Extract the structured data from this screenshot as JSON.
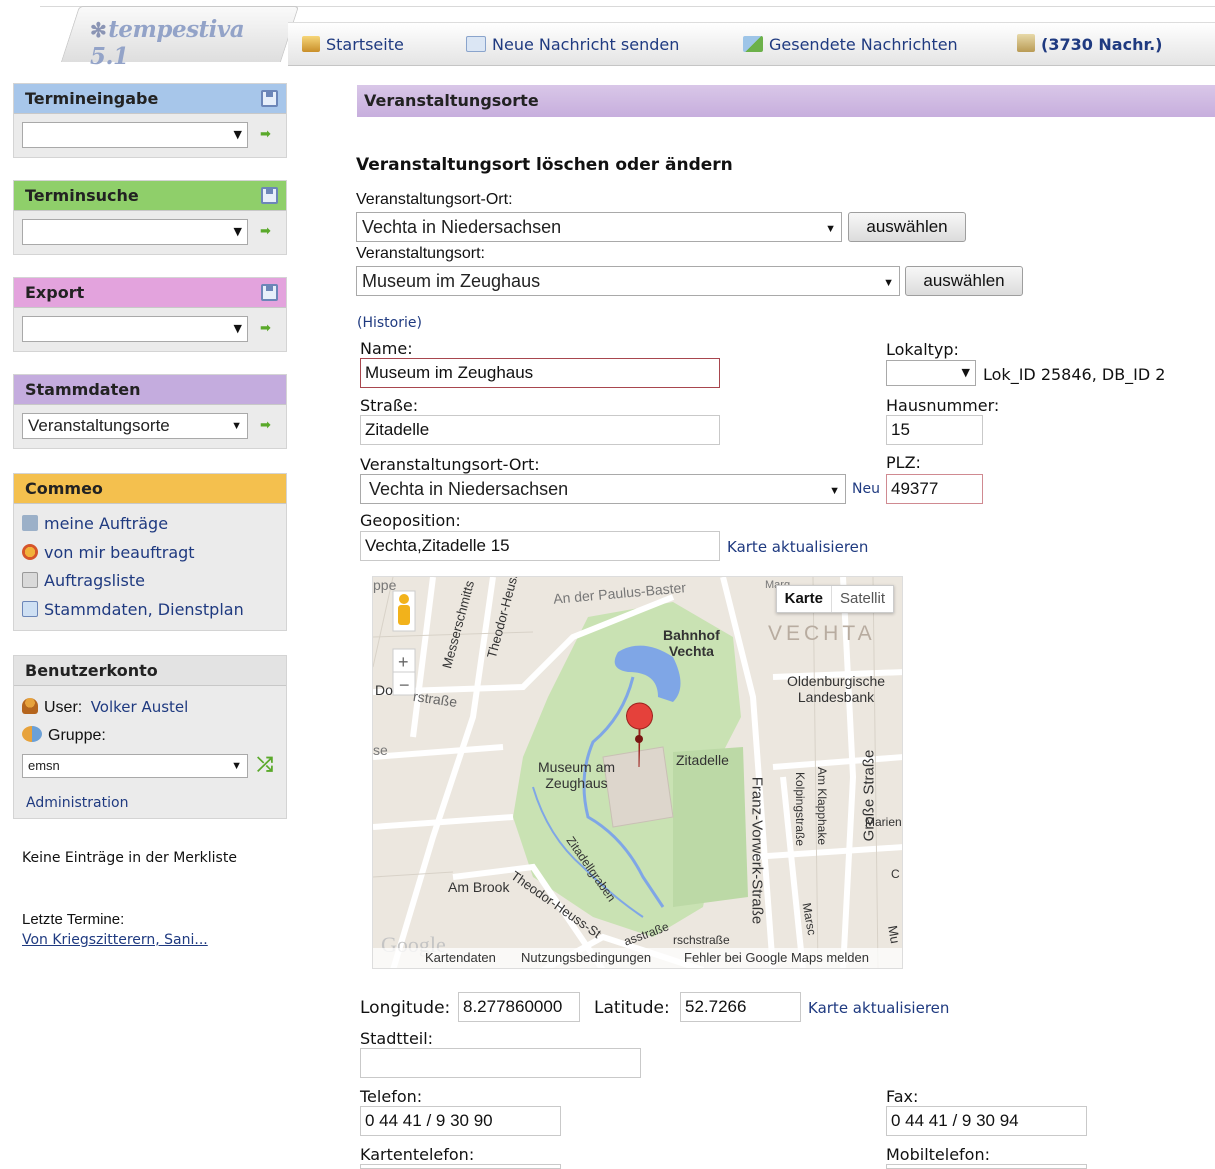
{
  "app": {
    "logo": "tempestiva 5.1"
  },
  "nav": {
    "home": "Startseite",
    "new_message": "Neue Nachricht senden",
    "sent_messages": "Gesendete Nachrichten",
    "messages_count": "(3730 Nachr.)"
  },
  "sidebar": {
    "termineingabe": {
      "title": "Termineingabe",
      "value": ""
    },
    "terminsuche": {
      "title": "Terminsuche",
      "value": ""
    },
    "export": {
      "title": "Export",
      "value": ""
    },
    "stammdaten": {
      "title": "Stammdaten",
      "value": "Veranstaltungsorte"
    },
    "commeo": {
      "title": "Commeo",
      "items": [
        "meine Aufträge",
        "von mir beauftragt",
        "Auftragsliste",
        "Stammdaten, Dienstplan"
      ]
    },
    "account": {
      "title": "Benutzerkonto",
      "user_label": "User:",
      "user_name": "Volker Austel",
      "group_label": "Gruppe:",
      "group_value": "emsn",
      "admin_link": "Administration"
    },
    "merkliste": "Keine Einträge in der Merkliste",
    "last_label": "Letzte Termine:",
    "last_link": "Von Kriegszitterern, Sani..."
  },
  "main": {
    "header": "Veranstaltungsorte",
    "section_title": "Veranstaltungsort löschen oder ändern",
    "place_city_label": "Veranstaltungsort-Ort:",
    "place_city_value": "Vechta in Niedersachsen",
    "select_button": "auswählen",
    "place_label": "Veranstaltungsort:",
    "place_value": "Museum im Zeughaus",
    "history_link": "(Historie)",
    "name_label": "Name:",
    "name_value": "Museum im Zeughaus",
    "lokaltyp_label": "Lokaltyp:",
    "lokaltyp_value": "",
    "lok_info": "Lok_ID 25846, DB_ID 2",
    "street_label": "Straße:",
    "street_value": "Zitadelle",
    "housenr_label": "Hausnummer:",
    "housenr_value": "15",
    "city_label": "Veranstaltungsort-Ort:",
    "city_value": "Vechta in Niedersachsen",
    "new_link": "Neu",
    "plz_label": "PLZ:",
    "plz_value": "49377",
    "geo_label": "Geoposition:",
    "geo_value": "Vechta,Zitadelle 15",
    "update_map": "Karte aktualisieren",
    "longitude_label": "Longitude:",
    "longitude_value": "8.277860000",
    "latitude_label": "Latitude:",
    "latitude_value": "52.7266",
    "district_label": "Stadtteil:",
    "district_value": "",
    "phone_label": "Telefon:",
    "phone_value": "0 44 41 / 9 30 90",
    "fax_label": "Fax:",
    "fax_value": "0 44 41 / 9 30 94",
    "cardphone_label": "Kartentelefon:",
    "mobile_label": "Mobiltelefon:"
  },
  "map": {
    "type_map": "Karte",
    "type_satellite": "Satellit",
    "footer": [
      "Kartendaten",
      "Nutzungsbedingungen",
      "Fehler bei Google Maps melden"
    ],
    "google": "Google",
    "labels": {
      "vechta": "VECHTA",
      "bahnhof": "Bahnhof\nVechta",
      "landesbank": "Oldenburgische\nLandesbank",
      "museum": "Museum am\nZeughaus",
      "zitadelle": "Zitadelle",
      "franz": "Franz-Vorwerk-Straße",
      "grosse": "Große Straße",
      "kolping": "Kolpingstraße",
      "klapphake": "Am Klapphake",
      "marien": "Marien",
      "ambrook": "Am Brook",
      "theodor1": "Theodor-Heuss-St",
      "theodor2": "Theodor-Heuss",
      "messer": "Messerschmitts",
      "paulus": "An der Paulus-Baster",
      "graben": "Zitadellgraben",
      "strasse": "rstraße",
      "do": "Do",
      "se": "se",
      "schstrasse": "rschstraße",
      "asstrasse": "asstraße",
      "marsc": "Marsc",
      "mu": "Mu",
      "pp": "ppe",
      "marg": "Marg",
      "c": "C"
    }
  },
  "colors": {
    "link": "#1f3a80",
    "termineingabe": "#a7c6ea",
    "terminsuche": "#8fcf6a",
    "export": "#e3a3dd",
    "stammdaten": "#c4acde",
    "commeo": "#f4c04e",
    "account": "#e3e3e3",
    "header": "#c7aedd"
  }
}
